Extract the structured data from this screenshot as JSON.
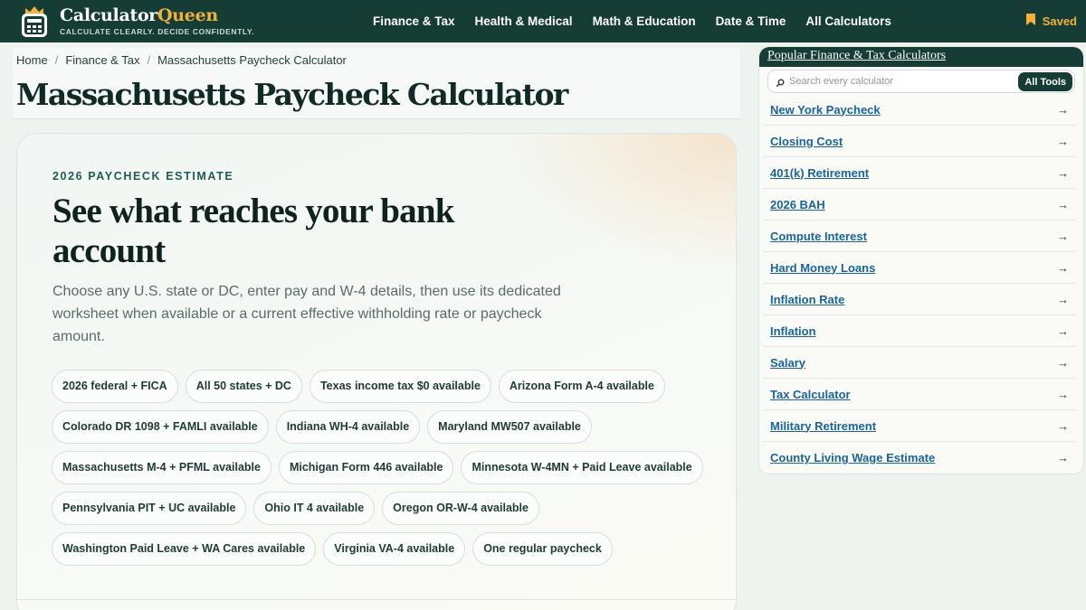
{
  "header": {
    "brand_part1": "Calculator",
    "brand_part2": "Queen",
    "tagline": "CALCULATE CLEARLY. DECIDE CONFIDENTLY.",
    "nav": [
      "Finance & Tax",
      "Health & Medical",
      "Math & Education",
      "Date & Time",
      "All Calculators"
    ],
    "saved_label": "Saved"
  },
  "breadcrumb": [
    "Home",
    "Finance & Tax",
    "Massachusetts Paycheck Calculator"
  ],
  "breadcrumb_sep": "/",
  "page_title": "Massachusetts Paycheck Calculator",
  "hero": {
    "eyebrow": "2026 PAYCHECK ESTIMATE",
    "heading": "See what reaches your bank account",
    "description": "Choose any U.S. state or DC, enter pay and W-4 details, then use its dedicated worksheet when available or a current effective withholding rate or paycheck amount.",
    "chips": [
      "2026 federal + FICA",
      "All 50 states + DC",
      "Texas income tax $0 available",
      "Arizona Form A-4 available",
      "Colorado DR 1098 + FAMLI available",
      "Indiana WH-4 available",
      "Maryland MW507 available",
      "Massachusetts M-4 + PFML available",
      "Michigan Form 446 available",
      "Minnesota W-4MN + Paid Leave available",
      "Pennsylvania PIT + UC available",
      "Ohio IT 4 available",
      "Oregon OR-W-4 available",
      "Washington Paid Leave + WA Cares available",
      "Virginia VA-4 available",
      "One regular paycheck"
    ]
  },
  "sidebar": {
    "title": "Popular Finance & Tax Calculators",
    "search_placeholder": "Search every calculator",
    "all_tools_label": "All Tools",
    "arrow": "→",
    "items": [
      "New York Paycheck",
      "Closing Cost",
      "401(k) Retirement",
      "2026 BAH",
      "Compute Interest",
      "Hard Money Loans",
      "Inflation Rate",
      "Inflation",
      "Salary",
      "Tax Calculator",
      "Military Retirement",
      "County Living Wage Estimate"
    ]
  },
  "colors": {
    "header_bg": "#153d36",
    "brand_accent": "#f2b13a",
    "link": "#19649c"
  },
  "icons": {
    "logo": "calculator-crown-icon",
    "saved": "bookmark-icon",
    "search": "search-icon"
  }
}
